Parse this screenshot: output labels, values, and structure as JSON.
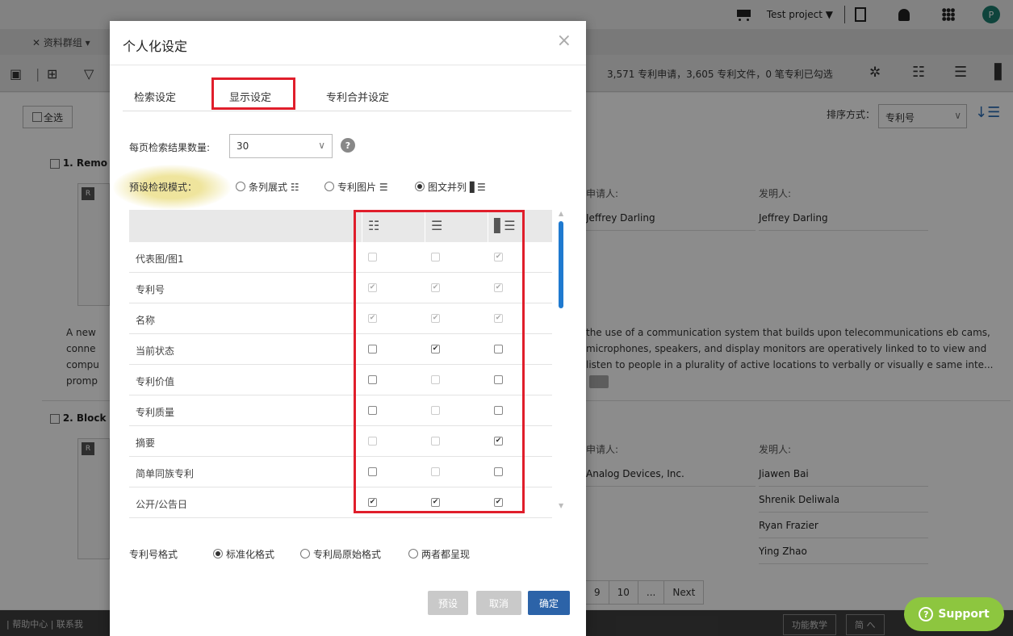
{
  "topbar": {
    "project": "Test project ▼",
    "avatar": "P"
  },
  "toolbar": {
    "group": "✕ 资料群组 ▾",
    "count": "3,571 专利申请，3,605 专利文件，0 笔专利已勾选"
  },
  "list": {
    "select_all": "全选",
    "sort_label": "排序方式：",
    "sort_value": "专利号",
    "item1_index": "1. Remo",
    "item2_index": "2. Block",
    "applicant_h": "申请人:",
    "inventor_h": "发明人:",
    "item1_applicant": "Jeffrey Darling",
    "item1_inventor": "Jeffrey Darling",
    "item2_applicant": "Analog Devices, Inc.",
    "item2_inventors": [
      "Jiawen Bai",
      "Shrenik Deliwala",
      "Ryan Frazier",
      "Ying Zhao"
    ],
    "abstract_left": "A new conne compu promp",
    "abstract_right": "the use of a communication system that builds upon telecommunications eb cams, microphones, speakers, and display monitors are operatively linked to to view and listen to people in a plurality of active locations to verbally or visually e same inte...",
    "pager": [
      "9",
      "10",
      "...",
      "Next"
    ]
  },
  "footer": {
    "links": "| 帮助中心 | 联系我",
    "tutorial": "功能教学",
    "lang": "简 へ"
  },
  "support": {
    "label": "Support"
  },
  "modal": {
    "title": "个人化设定",
    "close": "×",
    "tabs": [
      "检索设定",
      "显示设定",
      "专利合并设定"
    ],
    "active_tab": "显示设定",
    "per_page_label": "每页检索结果数量:",
    "per_page_value": "30",
    "view_mode_label": "预设检视模式：",
    "view_modes": [
      "条列展式 ☷",
      "专利图片 ☰",
      "图文并列 ▋☰"
    ],
    "view_mode_selected": "图文并列",
    "table_rows": [
      {
        "label": "代表图/图1",
        "checks": [
          false,
          false,
          true
        ],
        "dim": [
          true,
          true,
          true
        ]
      },
      {
        "label": "专利号",
        "checks": [
          true,
          true,
          true
        ],
        "dim": [
          true,
          true,
          true
        ]
      },
      {
        "label": "名称",
        "checks": [
          true,
          true,
          true
        ],
        "dim": [
          true,
          true,
          true
        ]
      },
      {
        "label": "当前状态",
        "checks": [
          false,
          true,
          false
        ],
        "dim": [
          false,
          false,
          false
        ]
      },
      {
        "label": "专利价值",
        "checks": [
          false,
          false,
          false
        ],
        "dim": [
          false,
          true,
          false
        ]
      },
      {
        "label": "专利质量",
        "checks": [
          false,
          false,
          false
        ],
        "dim": [
          false,
          true,
          false
        ]
      },
      {
        "label": "摘要",
        "checks": [
          false,
          false,
          true
        ],
        "dim": [
          true,
          true,
          false
        ]
      },
      {
        "label": "简单同族专利",
        "checks": [
          false,
          false,
          false
        ],
        "dim": [
          false,
          true,
          false
        ]
      },
      {
        "label": "公开/公告日",
        "checks": [
          true,
          true,
          true
        ],
        "dim": [
          false,
          false,
          false
        ]
      }
    ],
    "number_format_label": "专利号格式",
    "number_formats": [
      "标准化格式",
      "专利局原始格式",
      "两者都呈现"
    ],
    "number_format_selected": "标准化格式",
    "buttons": {
      "preset": "预设",
      "cancel": "取消",
      "ok": "确定"
    }
  },
  "colors": {
    "highlight": "#e01e2b",
    "primary": "#2c63a8",
    "support": "#8dc63f"
  }
}
